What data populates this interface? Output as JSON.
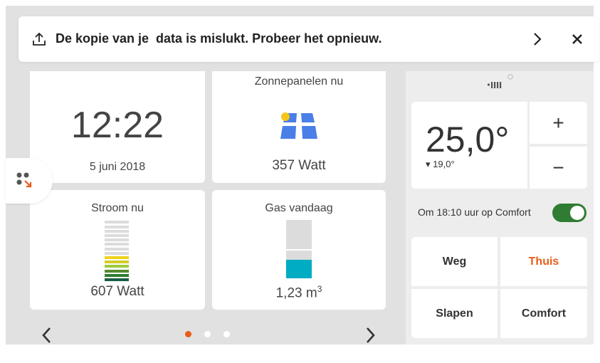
{
  "notification": {
    "message": "De kopie van je  data is mislukt. Probeer het opnieuw.",
    "upload_icon": "upload-icon",
    "chevron_icon": "chevron-right-icon",
    "close_icon": "close-icon"
  },
  "clock": {
    "time": "12:22",
    "date": "5 juni 2018"
  },
  "solar": {
    "title": "Zonnepanelen nu",
    "value": "357 Watt",
    "icon": "solar-panel-icon"
  },
  "power": {
    "title": "Stroom nu",
    "value": "607 Watt",
    "bar_levels_lit": 6,
    "bar_levels_total": 14
  },
  "gas": {
    "title": "Gas vandaag",
    "value": "1,23 m",
    "unit_sup": "3",
    "fill_fraction": 0.32
  },
  "thermostat": {
    "current_temp": "25,0°",
    "setpoint": "▾ 19,0°",
    "plus_label": "+",
    "minus_label": "−",
    "program_text": "Om 18:10 uur op Comfort",
    "program_enabled": true
  },
  "presets": [
    {
      "label": "Weg",
      "active": false
    },
    {
      "label": "Thuis",
      "active": true
    },
    {
      "label": "Slapen",
      "active": false
    },
    {
      "label": "Comfort",
      "active": false
    }
  ],
  "pagination": {
    "current": 1,
    "total": 3
  },
  "colors": {
    "accent": "#e85d1a",
    "toggle_on": "#2e7d32",
    "gas_fill": "#00acc1",
    "solar_blue": "#4a7fe8",
    "sun_yellow": "#f5c518"
  }
}
